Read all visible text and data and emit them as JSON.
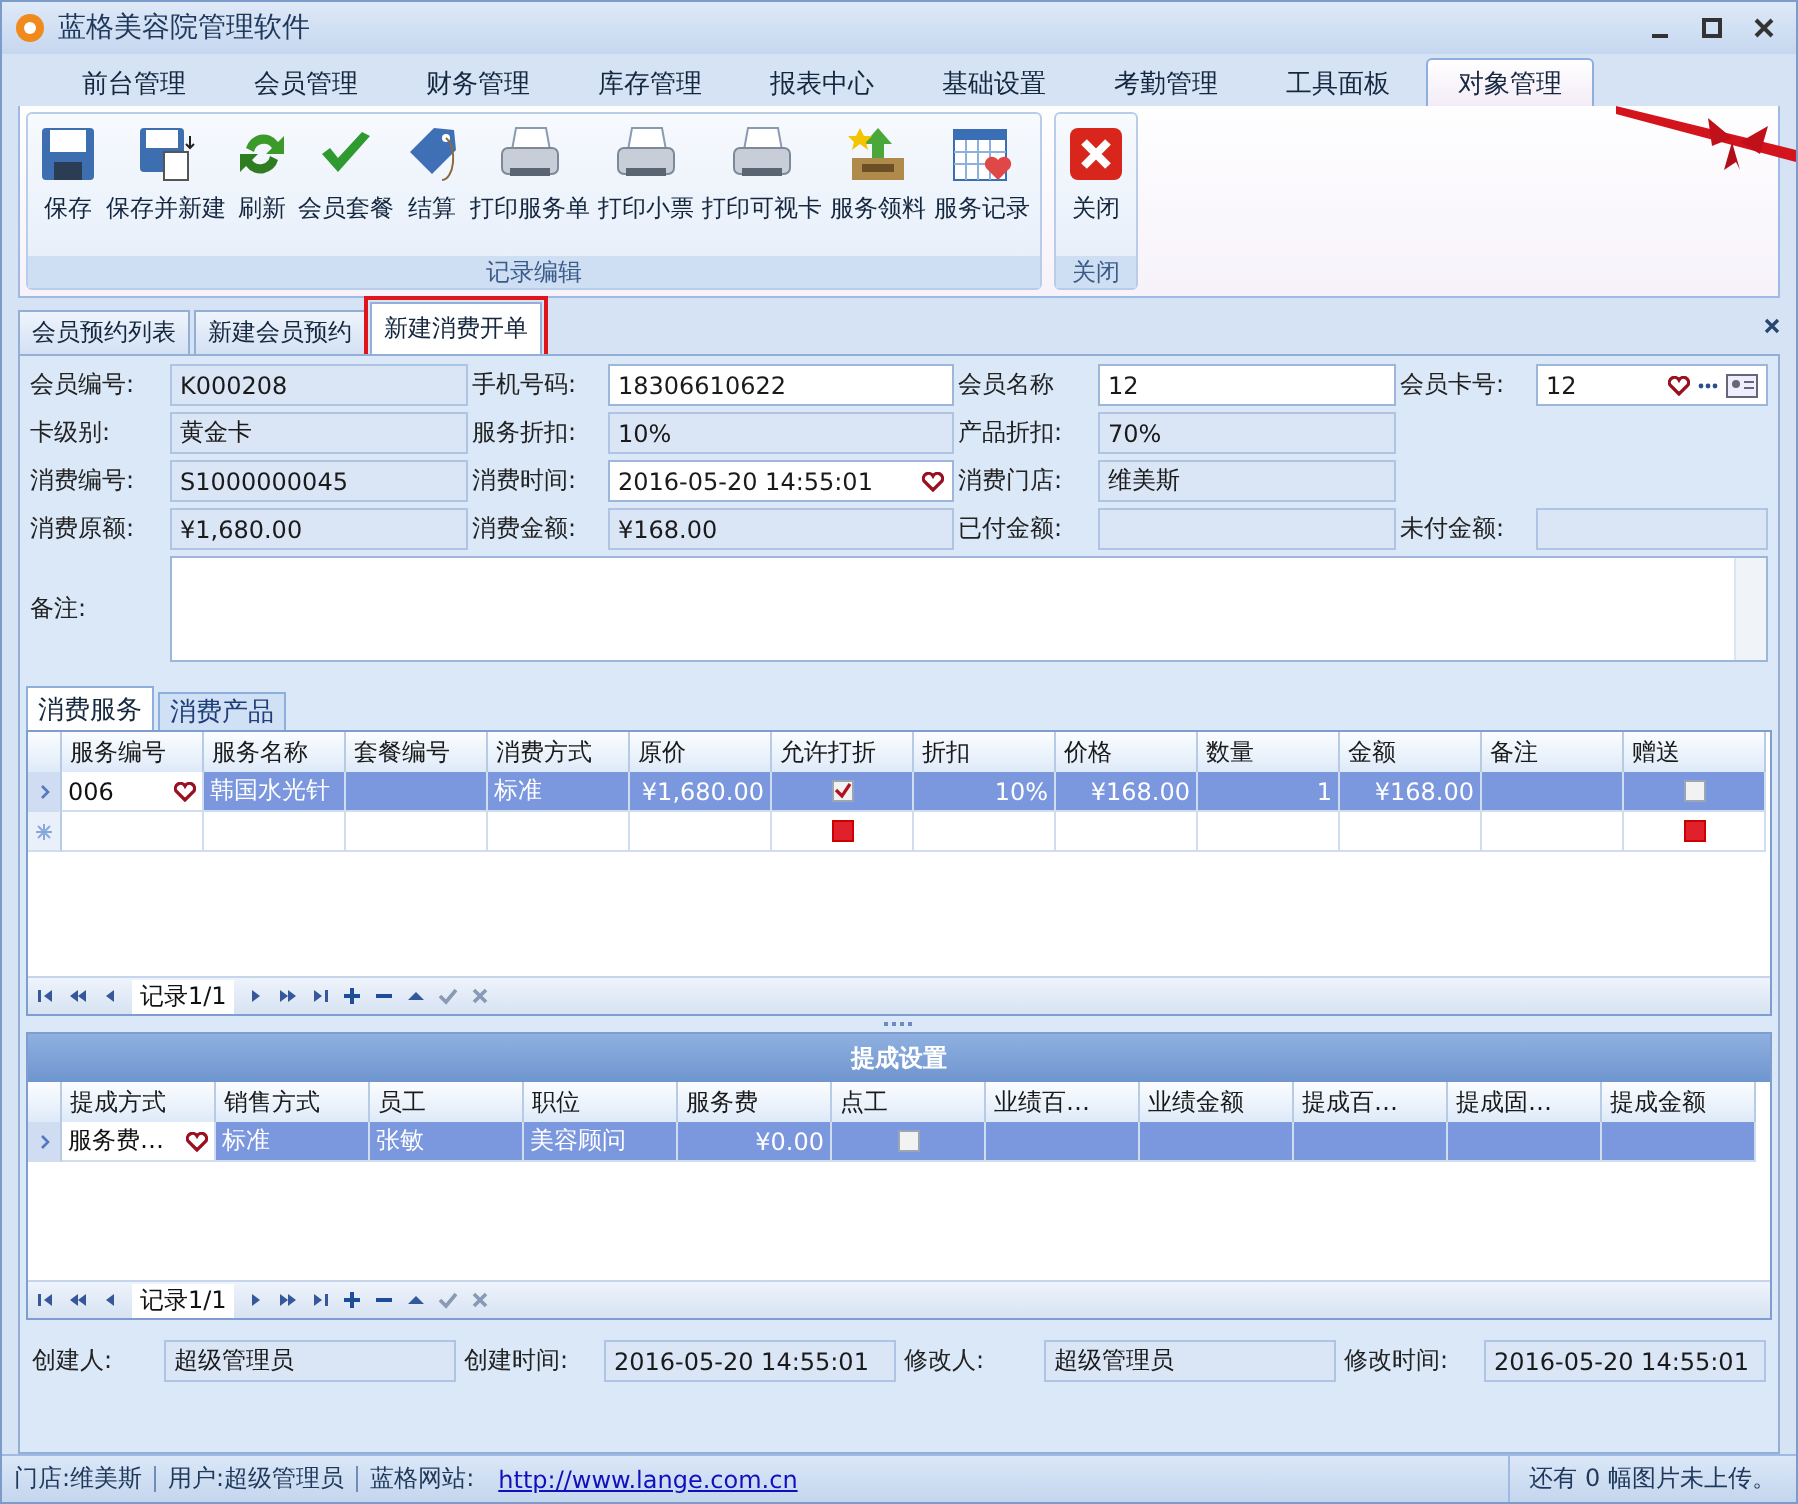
{
  "window": {
    "title": "蓝格美容院管理软件"
  },
  "menu_tabs": [
    {
      "label": "前台管理",
      "selected": false
    },
    {
      "label": "会员管理",
      "selected": false
    },
    {
      "label": "财务管理",
      "selected": false
    },
    {
      "label": "库存管理",
      "selected": false
    },
    {
      "label": "报表中心",
      "selected": false
    },
    {
      "label": "基础设置",
      "selected": false
    },
    {
      "label": "考勤管理",
      "selected": false
    },
    {
      "label": "工具面板",
      "selected": false
    },
    {
      "label": "对象管理",
      "selected": true
    }
  ],
  "ribbon": {
    "groups": [
      {
        "title": "记录编辑",
        "buttons": [
          {
            "label": "保存",
            "kind": "save"
          },
          {
            "label": "保存并新建",
            "kind": "save-new"
          },
          {
            "label": "刷新",
            "kind": "refresh"
          },
          {
            "label": "会员套餐",
            "kind": "check"
          },
          {
            "label": "结算",
            "kind": "tag"
          },
          {
            "label": "打印服务单",
            "kind": "print"
          },
          {
            "label": "打印小票",
            "kind": "print"
          },
          {
            "label": "打印可视卡",
            "kind": "print"
          },
          {
            "label": "服务领料",
            "kind": "tray"
          },
          {
            "label": "服务记录",
            "kind": "calendar"
          }
        ]
      },
      {
        "title": "关闭",
        "buttons": [
          {
            "label": "关闭",
            "kind": "close"
          }
        ]
      }
    ]
  },
  "doc_tabs": [
    {
      "label": "会员预约列表",
      "selected": false
    },
    {
      "label": "新建会员预约",
      "selected": false
    },
    {
      "label": "新建消费开单",
      "selected": true,
      "highlighted": true
    }
  ],
  "form": {
    "fields": [
      {
        "label": "会员编号:",
        "value": "K000208",
        "editable": false
      },
      {
        "label": "手机号码:",
        "value": "18306610622",
        "editable": true
      },
      {
        "label": "会员名称",
        "value": "12",
        "editable": true
      },
      {
        "label": "会员卡号:",
        "value": "12",
        "editable": true,
        "kind": "card"
      },
      {
        "label": "卡级别:",
        "value": "黄金卡",
        "editable": false
      },
      {
        "label": "服务折扣:",
        "value": "10%",
        "editable": false
      },
      {
        "label": "产品折扣:",
        "value": "70%",
        "editable": false
      },
      {
        "kind": "none"
      },
      {
        "label": "消费编号:",
        "value": "S1000000045",
        "editable": false
      },
      {
        "label": "消费时间:",
        "value": "2016-05-20 14:55:01",
        "editable": true,
        "kind": "picker"
      },
      {
        "label": "消费门店:",
        "value": "维美斯",
        "editable": false
      },
      {
        "kind": "none"
      },
      {
        "label": "消费原额:",
        "value": "¥1,680.00",
        "editable": false
      },
      {
        "label": "消费金额:",
        "value": "¥168.00",
        "editable": false
      },
      {
        "label": "已付金额:",
        "editable": false
      },
      {
        "label": "未付金额:",
        "editable": false
      }
    ],
    "note": {
      "label": "备注:"
    }
  },
  "sub_tabs": [
    {
      "label": "消费服务",
      "selected": true
    },
    {
      "label": "消费产品",
      "selected": false
    }
  ],
  "service_grid": {
    "columns": [
      {
        "label": "服务编号",
        "kind": "text"
      },
      {
        "label": "服务名称",
        "kind": "text"
      },
      {
        "label": "套餐编号",
        "kind": "text"
      },
      {
        "label": "消费方式",
        "kind": "text"
      },
      {
        "label": "原价",
        "kind": "number"
      },
      {
        "label": "允许打折",
        "kind": "check"
      },
      {
        "label": "折扣",
        "kind": "number"
      },
      {
        "label": "价格",
        "kind": "number"
      },
      {
        "label": "数量",
        "kind": "number"
      },
      {
        "label": "金额",
        "kind": "number"
      },
      {
        "label": "备注",
        "kind": "text"
      },
      {
        "label": "赠送",
        "kind": "check"
      }
    ],
    "rows": [
      {
        "kind": "record",
        "selected": true,
        "cells": [
          {
            "text": "006",
            "editor": true
          },
          {
            "text": "韩国水光针"
          },
          {},
          {
            "text": "标准"
          },
          {
            "text": "¥1,680.00"
          },
          {
            "checked": true
          },
          {
            "text": "10%"
          },
          {
            "text": "¥168.00"
          },
          {
            "text": "1"
          },
          {
            "text": "¥168.00"
          },
          {},
          {
            "checked": false
          }
        ]
      },
      {
        "kind": "new",
        "selected": false,
        "cells": [
          {},
          {},
          {},
          {},
          {},
          {
            "kind": "null"
          },
          {},
          {},
          {},
          {},
          {},
          {
            "kind": "null"
          }
        ]
      }
    ],
    "navigator": "记录1/1"
  },
  "commission_grid": {
    "title": "提成设置",
    "columns": [
      {
        "label": "提成方式",
        "kind": "text"
      },
      {
        "label": "销售方式",
        "kind": "text"
      },
      {
        "label": "员工",
        "kind": "text"
      },
      {
        "label": "职位",
        "kind": "text"
      },
      {
        "label": "服务费",
        "kind": "number"
      },
      {
        "label": "点工",
        "kind": "check"
      },
      {
        "label": "业绩百…",
        "kind": "text"
      },
      {
        "label": "业绩金额",
        "kind": "text"
      },
      {
        "label": "提成百…",
        "kind": "text"
      },
      {
        "label": "提成固…",
        "kind": "text"
      },
      {
        "label": "提成金额",
        "kind": "text"
      }
    ],
    "rows": [
      {
        "kind": "record",
        "selected": true,
        "cells": [
          {
            "text": "服务费…",
            "editor": true
          },
          {
            "text": "标准"
          },
          {
            "text": "张敏"
          },
          {
            "text": "美容顾问"
          },
          {
            "text": "¥0.00"
          },
          {
            "checked": false
          },
          {},
          {},
          {},
          {},
          {}
        ]
      }
    ],
    "navigator": "记录1/1"
  },
  "footer": [
    {
      "label": "创建人:",
      "value": "超级管理员"
    },
    {
      "label": "创建时间:",
      "value": "2016-05-20 14:55:01"
    },
    {
      "label": "修改人:",
      "value": "超级管理员"
    },
    {
      "label": "修改时间:",
      "value": "2016-05-20 14:55:01"
    }
  ],
  "status_bar": {
    "items": [
      {
        "label": "门店:",
        "value": "维美斯"
      },
      {
        "label": "用户:",
        "value": "超级管理员"
      },
      {
        "label": "蓝格网站:",
        "link": "http://www.lange.com.cn"
      }
    ],
    "message": "还有 0 幅图片未上传。"
  }
}
